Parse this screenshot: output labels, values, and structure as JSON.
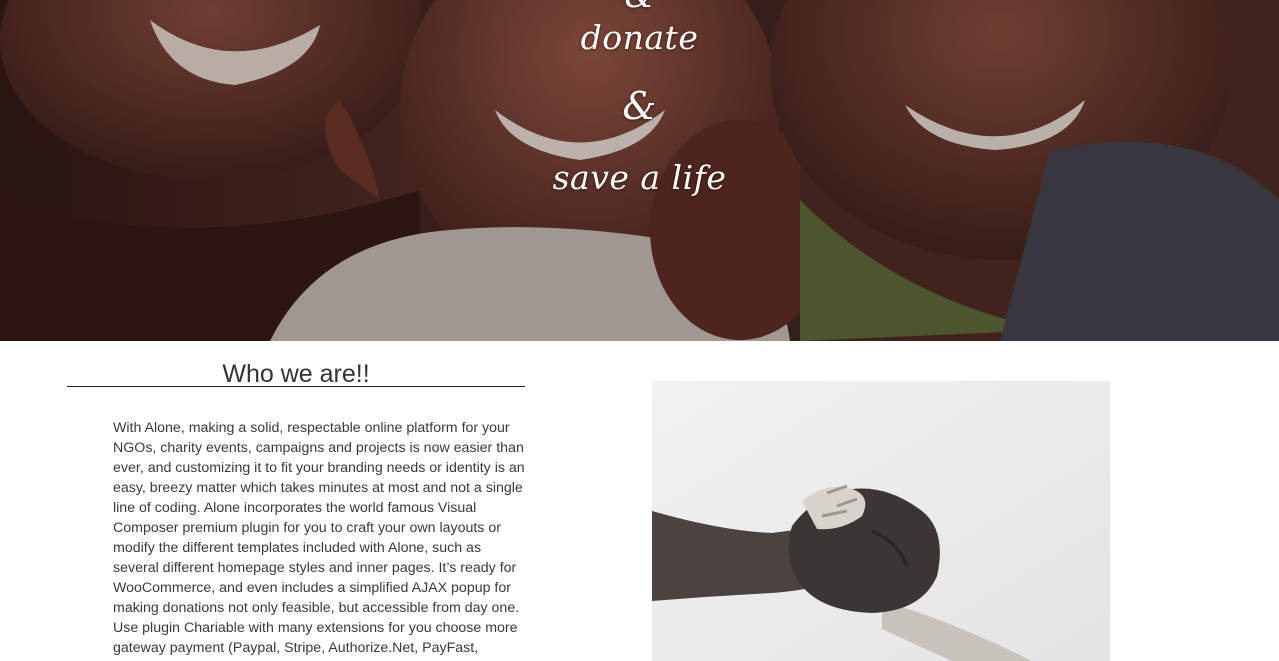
{
  "hero": {
    "line_partial": "&",
    "line_donate": "donate",
    "line_ampersand": "&",
    "line_save": "save a life",
    "image_name": "smiling-children-photo"
  },
  "about": {
    "title": "Who we are!!",
    "body": "With Alone, making a solid, respectable online platform for your NGOs, charity events, campaigns and projects is now easier than ever, and customizing it to fit your branding needs or identity is an easy, breezy matter which takes minutes at most and not a single line of coding. Alone incorporates the world famous Visual Composer premium plugin for you to craft your own layouts or modify the different templates included with Alone, such as several different homepage styles and inner pages. It’s ready for WooCommerce, and even includes a simplified AJAX popup for making donations not only feasible, but accessible from day one. Use plugin Chariable with many extensions for you choose more gateway payment (Paypal, Stripe, Authorize.Net, PayFast,",
    "image_name": "handshake-photo"
  },
  "colors": {
    "hero_overlay": "#2b1613",
    "text": "#333333",
    "rule": "#222222"
  }
}
